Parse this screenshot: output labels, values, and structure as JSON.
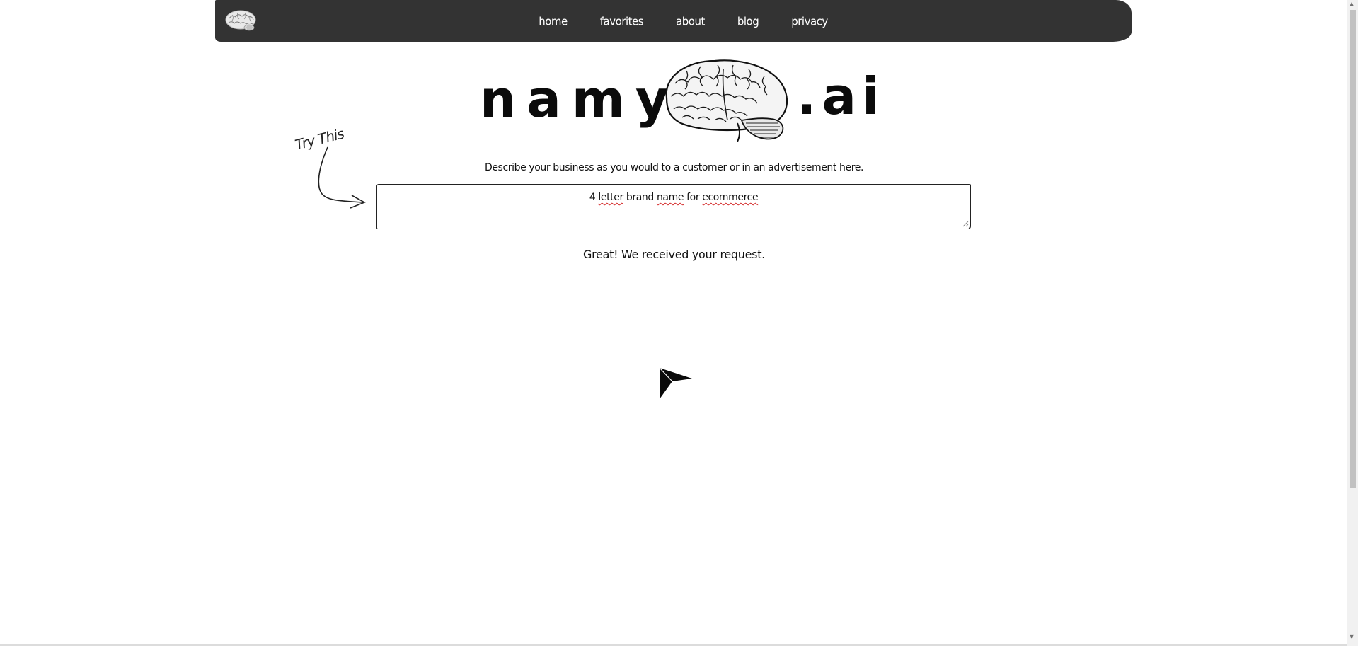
{
  "nav": {
    "logo_icon": "brain-icon",
    "links": [
      {
        "label": "home"
      },
      {
        "label": "favorites"
      },
      {
        "label": "about"
      },
      {
        "label": "blog"
      },
      {
        "label": "privacy"
      }
    ]
  },
  "brand": {
    "name_left": "namy",
    "name_right": ".ai",
    "logo_icon": "brain-icon"
  },
  "annotation": {
    "label": "Try This",
    "arrow_icon": "curved-arrow-icon"
  },
  "form": {
    "prompt": "Describe your business as you would to a customer or in an advertisement here.",
    "description_value": "4 letter brand name for ecommerce",
    "status_message": "Great! We received your request.",
    "submit_icon": "send-arrow-icon"
  },
  "colors": {
    "navbar_bg": "#333333",
    "nav_text": "#ffffff",
    "page_bg": "#ffffff",
    "spellcheck_underline": "#d42a2a"
  }
}
